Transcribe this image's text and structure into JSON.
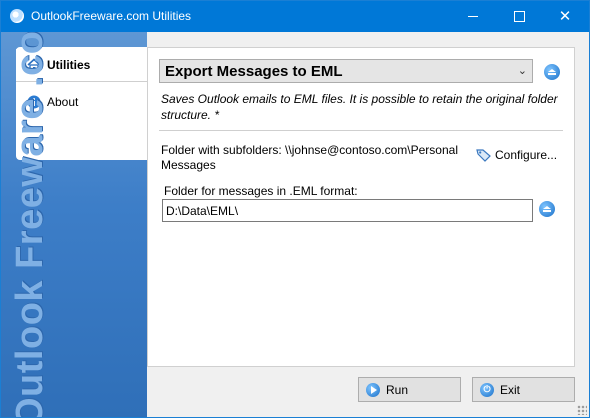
{
  "window": {
    "title": "OutlookFreeware.com Utilities",
    "minimize_label": "",
    "maximize_label": "",
    "close_label": "✕"
  },
  "sidebar": {
    "tabs": [
      {
        "label": "Utilities",
        "icon": "home-icon",
        "active": true
      },
      {
        "label": "About",
        "icon": "info-icon",
        "active": false
      }
    ],
    "watermark": "Outlook Freeware .com"
  },
  "main": {
    "utility_select": {
      "value": "Export Messages to EML"
    },
    "description": "Saves Outlook emails to EML files. It is possible to retain the original folder structure. *",
    "folder_label": "Folder with subfolders: \\\\johnse@contoso.com\\Personal Messages",
    "configure_label": "Configure...",
    "eml_label": "Folder for messages in .EML format:",
    "eml_path": "D:\\Data\\EML\\"
  },
  "footer": {
    "run_label": "Run",
    "exit_label": "Exit"
  },
  "colors": {
    "titlebar": "#0078d7",
    "sidebar": "#3d7ec8",
    "accent_icon": "#1a70c8"
  }
}
